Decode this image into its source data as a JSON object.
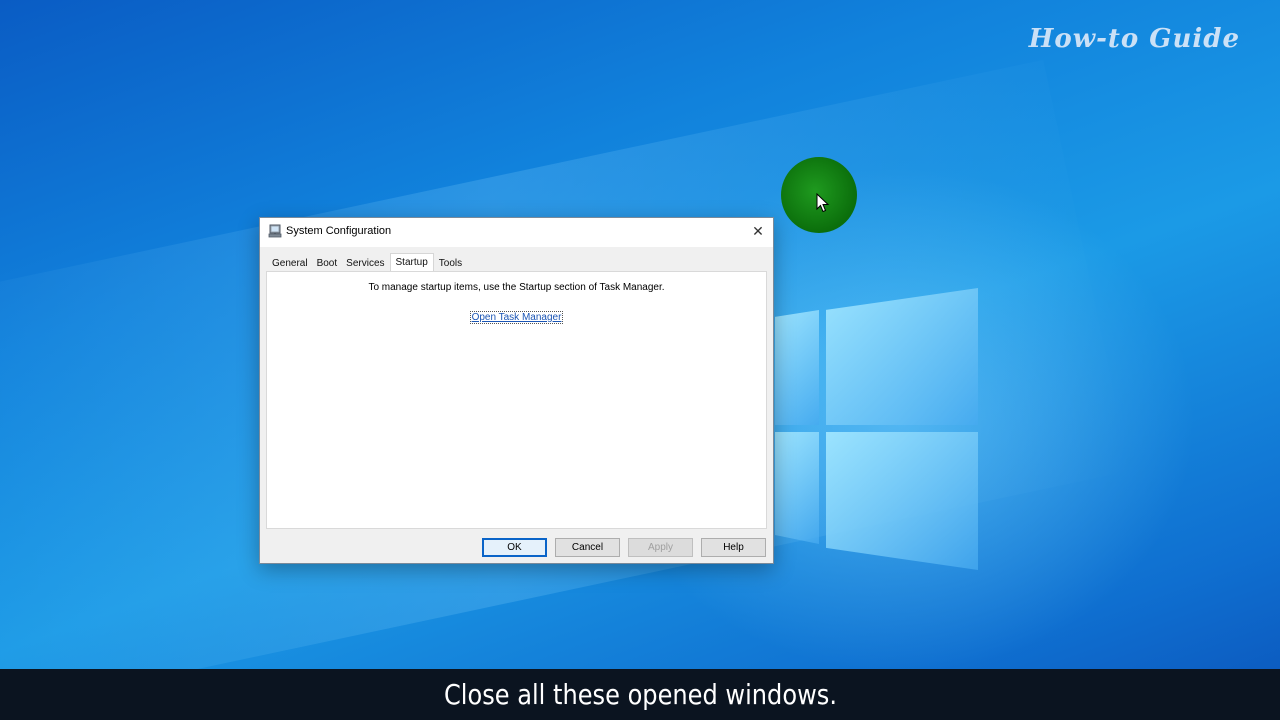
{
  "watermark": "How-to Guide",
  "dialog": {
    "title": "System Configuration",
    "close_glyph": "✕",
    "tabs": [
      {
        "label": "General"
      },
      {
        "label": "Boot"
      },
      {
        "label": "Services"
      },
      {
        "label": "Startup",
        "active": true
      },
      {
        "label": "Tools"
      }
    ],
    "info_text": "To manage startup items, use the Startup section of Task Manager.",
    "link_text": "Open Task Manager",
    "buttons": {
      "ok": "OK",
      "cancel": "Cancel",
      "apply": "Apply",
      "help": "Help"
    }
  },
  "caption": "Close all these opened windows.",
  "colors": {
    "accent_blue": "#0a64c8",
    "link": "#1a55b5",
    "cursor_highlight": "#1f9a1f",
    "caption_bg": "#0b1420"
  },
  "icons": {
    "app": "system-config-icon",
    "close": "close-icon",
    "cursor": "mouse-pointer-icon"
  }
}
